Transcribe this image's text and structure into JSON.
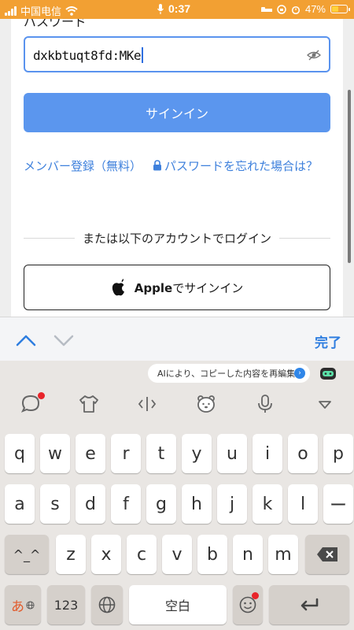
{
  "status_bar": {
    "carrier": "中国电信",
    "time": "0:37",
    "battery": "47%",
    "battery_level": 0.47
  },
  "form": {
    "password_label": "パスワード",
    "password_value": "dxkbtuqt8fd:MKe",
    "signin_button": "サインイン",
    "member_link": "メンバー登録（無料）",
    "forgot_link": "パスワードを忘れた場合は？",
    "divider_text": "または以下のアカウントでログイン",
    "apple_button_brand": "Apple",
    "apple_button_text": "でサインイン"
  },
  "keyboard_toolbar": {
    "done_label": "完了"
  },
  "keyboard": {
    "ai_banner": "AIにより、コピーした内容を再編集！",
    "row1": [
      "q",
      "w",
      "e",
      "r",
      "t",
      "y",
      "u",
      "i",
      "o",
      "p"
    ],
    "row2": [
      "a",
      "s",
      "d",
      "f",
      "g",
      "h",
      "j",
      "k",
      "l",
      "ー"
    ],
    "row3_left": "^_^",
    "row3": [
      "z",
      "x",
      "c",
      "v",
      "b",
      "n",
      "m"
    ],
    "mode_key": "あ",
    "num_key": "123",
    "space_key": "空白"
  },
  "colors": {
    "status_bar": "#f2a033",
    "accent": "#5b96ee",
    "link": "#3e80dc",
    "done": "#2f7ee0",
    "keyboard_bg": "#e9e6e3"
  },
  "icons": [
    "signal-icon",
    "wifi-icon",
    "mic-icon",
    "alarm-icon",
    "battery-icon",
    "eye-icon",
    "lock-icon",
    "apple-icon",
    "chevron-up-icon",
    "chevron-down-icon",
    "chat-icon",
    "shirt-icon",
    "cursor-icon",
    "bear-icon",
    "mic-icon",
    "collapse-icon",
    "globe-icon",
    "emoji-icon",
    "backspace-icon",
    "return-icon"
  ]
}
